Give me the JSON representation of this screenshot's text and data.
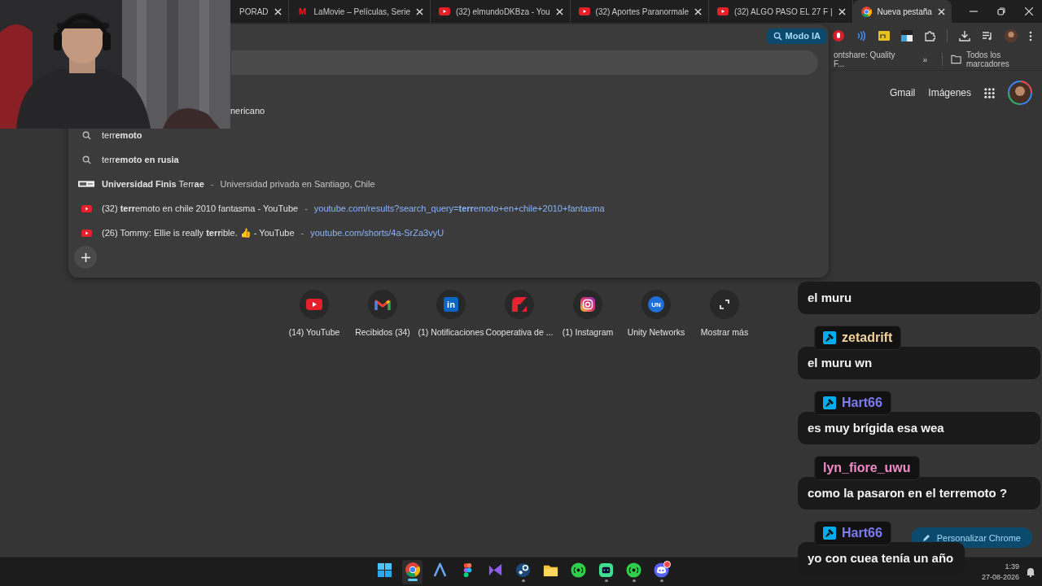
{
  "tabs": [
    {
      "title": "PORAD",
      "kind": "none",
      "selected": false
    },
    {
      "title": "LaMovie – Películas, Serie",
      "kind": "letter",
      "glyph": "M",
      "selected": false
    },
    {
      "title": "(32) elmundoDKBza - You",
      "kind": "youtube",
      "selected": false
    },
    {
      "title": "(32) Aportes Paranormale",
      "kind": "youtube",
      "selected": false
    },
    {
      "title": "(32) ALGO PASO EL 27 F |",
      "kind": "youtube",
      "selected": false
    },
    {
      "title": "Nueva pestaña",
      "kind": "chrome",
      "selected": true
    }
  ],
  "toolbar": {
    "ai_mode_button": "Modo IA"
  },
  "bookmarks_bar": {
    "item": "ontshare: Quality F...",
    "overflow": "»",
    "all_bookmarks": "Todos los marcadores"
  },
  "omnibox_suggestions": [
    {
      "kind": "cut",
      "text": "nericano"
    },
    {
      "kind": "search",
      "text": "terr**emoto**"
    },
    {
      "kind": "search",
      "text": "terr**emoto en rusia**"
    },
    {
      "kind": "site",
      "text": "**Universidad Finis** Terr**ae**",
      "separator": "-",
      "detail": "Universidad privada en Santiago, Chile"
    },
    {
      "kind": "video",
      "text": "(32) **terr**emoto en chile 2010 fantasma - YouTube",
      "separator": "-",
      "url": "youtube.com/results?search_query=**terr**emoto+en+chile+2010+fantasma"
    },
    {
      "kind": "video",
      "text": "(26) Tommy: Ellie is really **terr**ible. 👍 - YouTube",
      "separator": "-",
      "url": "youtube.com/shorts/4a-SrZa3vyU"
    }
  ],
  "ntp": {
    "header_links": [
      "Gmail",
      "Imágenes"
    ],
    "shortcuts": [
      {
        "label": "(14) YouTube",
        "kind": "youtube"
      },
      {
        "label": "Recibidos (34)",
        "kind": "gmail"
      },
      {
        "label": "(1) Notificaciones",
        "kind": "linkedin",
        "glyph": "in"
      },
      {
        "label": "Cooperativa de ...",
        "kind": "cooperativa"
      },
      {
        "label": "(1) Instagram",
        "kind": "instagram"
      },
      {
        "label": "Unity Networks",
        "kind": "unity",
        "glyph": "UN"
      },
      {
        "label": "Mostrar más",
        "kind": "expand"
      }
    ]
  },
  "customize_button": "Personalizar Chrome",
  "chat": [
    {
      "text": "el muru"
    },
    {
      "user": "zetadrift",
      "color": "#f2d29b",
      "moderator": true,
      "text": "el muru wn"
    },
    {
      "user": "Hart66",
      "color": "#7d7cf2",
      "moderator": true,
      "text": "es muy brígida esa wea"
    },
    {
      "user": "lyn_fiore_uwu",
      "color": "#f08ac8",
      "moderator": false,
      "text": "como la pasaron en el terremoto ?"
    },
    {
      "user": "Hart66",
      "color": "#7d7cf2",
      "moderator": true,
      "text": "yo con cuea tenía un año"
    }
  ],
  "taskbar": {
    "apps": [
      {
        "kind": "windows",
        "selected": false,
        "running": false,
        "notification": false
      },
      {
        "kind": "chrome",
        "selected": true,
        "running": true,
        "notification": false
      },
      {
        "kind": "arrow",
        "selected": false,
        "running": false,
        "notification": false
      },
      {
        "kind": "figma",
        "selected": false,
        "running": false,
        "notification": false
      },
      {
        "kind": "studio",
        "selected": false,
        "running": false,
        "notification": false
      },
      {
        "kind": "steam",
        "selected": false,
        "running": true,
        "notification": false
      },
      {
        "kind": "folder",
        "selected": false,
        "running": false,
        "notification": false
      },
      {
        "kind": "broadcast",
        "selected": false,
        "running": false,
        "notification": false
      },
      {
        "kind": "robot",
        "selected": false,
        "running": true,
        "notification": false
      },
      {
        "kind": "broadcast",
        "selected": false,
        "running": true,
        "notification": false
      },
      {
        "kind": "discord",
        "selected": false,
        "running": true,
        "notification": true
      }
    ],
    "time": "1:39",
    "date": "27-08-2026"
  }
}
